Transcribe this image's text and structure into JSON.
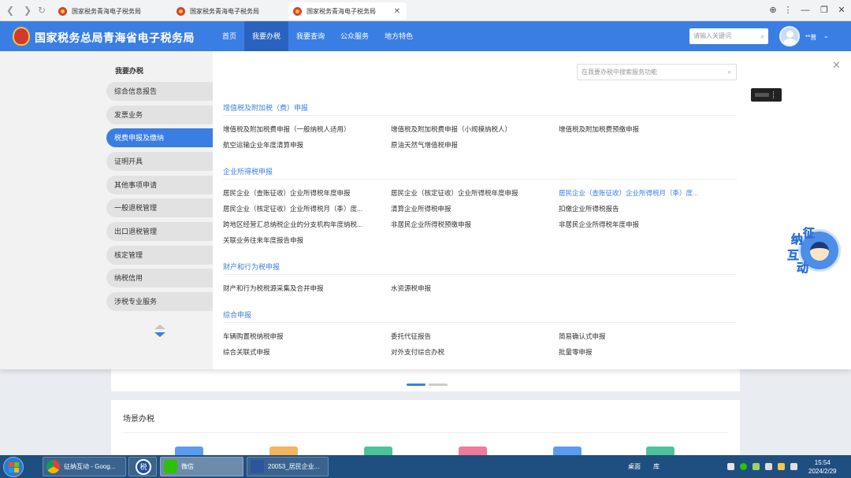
{
  "browser": {
    "tabs": [
      {
        "title": "国家税务青海电子税务局",
        "active": false
      },
      {
        "title": "国家税务青海电子税务局",
        "active": false
      },
      {
        "title": "国家税务青海电子税务局",
        "active": true
      }
    ],
    "close_glyph": "✕",
    "nav_icons": [
      "back-icon",
      "forward-icon",
      "reload-icon"
    ]
  },
  "header": {
    "title": "国家税务总局青海省电子税务局",
    "nav": [
      "首页",
      "我要办税",
      "我要查询",
      "公众服务",
      "地方特色"
    ],
    "active_nav": "我要办税",
    "search_placeholder": "请输入关键词",
    "username": "**普"
  },
  "leftmenu": {
    "title": "我要办税",
    "items": [
      "综合信息报告",
      "发票业务",
      "税费申报及缴纳",
      "证明开具",
      "其他事项申请",
      "一般退税管理",
      "出口退税管理",
      "核定管理",
      "纳税信用",
      "涉税专业服务"
    ],
    "active": "税费申报及缴纳"
  },
  "content": {
    "search_placeholder": "在我要办税中搜索服务功能",
    "sections": [
      {
        "title": "增值税及附加税（费）申报",
        "links": [
          "增值税及附加税费申报（一般纳税人适用）",
          "增值税及附加税费申报（小规模纳税人）",
          "增值税及附加税费预缴申报",
          "航空运输企业年度清算申报",
          "原油天然气增值税申报"
        ]
      },
      {
        "title": "企业所得税申报",
        "links": [
          "居民企业（查账征收）企业所得税年度申报",
          "居民企业（核定征收）企业所得税年度申报",
          "居民企业（查账征收）企业所得税月（季）度...",
          "居民企业（核定征收）企业所得税月（季）度...",
          "清算企业所得税申报",
          "扣缴企业所得税报告",
          "跨地区经营汇总纳税企业的分支机构年度纳税...",
          "非居民企业所得税预缴申报",
          "非居民企业所得税年度申报",
          "关联业务往来年度报告申报"
        ]
      },
      {
        "title": "财产和行为税申报",
        "links": [
          "财产和行为税税源采集及合并申报",
          "水资源税申报"
        ]
      },
      {
        "title": "综合申报",
        "links": [
          "车辆购置税纳税申报",
          "委托代征报告",
          "简易确认式申报",
          "综合关联式申报",
          "对外支付综合办税",
          "批量零申报"
        ]
      }
    ],
    "highlighted_link": "居民企业（查账征收）企业所得税月（季）度..."
  },
  "mascot": {
    "chars": [
      "征",
      "纳",
      "互",
      "动"
    ]
  },
  "background_page": {
    "scene_title": "场景办税",
    "carousel_active_index": 0,
    "carousel_count": 2
  },
  "taskbar": {
    "windows": [
      {
        "label": "征纳互动 - Goog...",
        "icon": "chrome-icon"
      },
      {
        "label": "",
        "icon": "tax-app-icon"
      },
      {
        "label": "微信",
        "icon": "wechat-icon"
      },
      {
        "label": "20053_居民企业...",
        "icon": "word-icon"
      }
    ],
    "tray_desktop": "桌面",
    "tray_library": "库",
    "time": "15:54",
    "date": "2024/2/29"
  },
  "colors": {
    "accent": "#3a7ee4",
    "header_bg": "#3a7ee4",
    "taskbar_bg": "#1f4f80"
  }
}
